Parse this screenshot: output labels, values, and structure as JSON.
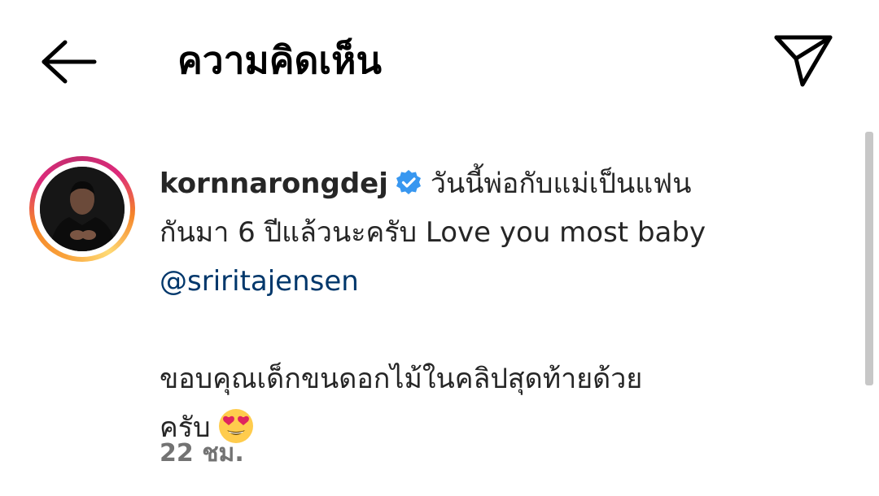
{
  "header": {
    "title": "ความคิดเห็น",
    "back_icon": "arrow-left-icon",
    "share_icon": "paper-plane-icon"
  },
  "comment": {
    "username": "kornnarongdej",
    "verified": true,
    "text_line1": "วันนี้พ่อกับแม่เป็นแฟน",
    "text_line2": "กันมา 6 ปีแล้วนะครับ Love you most baby",
    "mention": "@sriritajensen",
    "text_line3": "ขอบคุณเด็กขนดอกไม้ในคลิปสุดท้ายด้วย",
    "text_line4": "ครับ",
    "emoji": "smiling-face-with-heart-eyes",
    "timestamp": "22 ชม."
  },
  "colors": {
    "verified_blue": "#3897f0",
    "mention_blue": "#00376b",
    "timestamp_gray": "#737373"
  }
}
